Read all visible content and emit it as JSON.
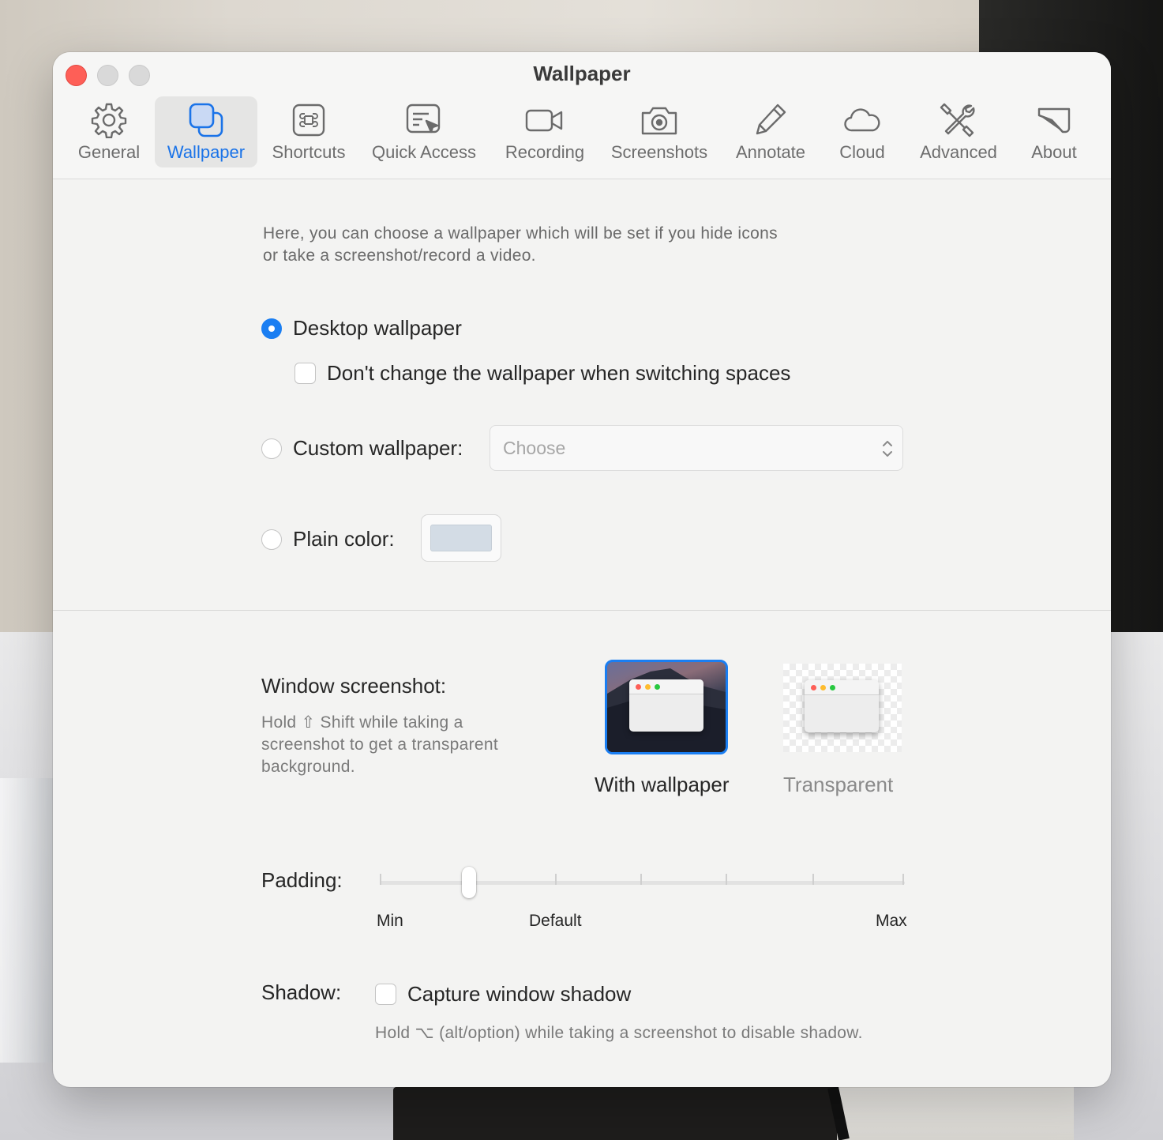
{
  "window": {
    "title": "Wallpaper"
  },
  "toolbar": {
    "items": [
      {
        "label": "General",
        "icon": "gear-icon"
      },
      {
        "label": "Wallpaper",
        "icon": "overlapping-squares-icon",
        "active": true
      },
      {
        "label": "Shortcuts",
        "icon": "command-key-icon"
      },
      {
        "label": "Quick Access",
        "icon": "quick-access-icon"
      },
      {
        "label": "Recording",
        "icon": "video-camera-icon"
      },
      {
        "label": "Screenshots",
        "icon": "camera-icon"
      },
      {
        "label": "Annotate",
        "icon": "pencil-icon"
      },
      {
        "label": "Cloud",
        "icon": "cloud-icon"
      },
      {
        "label": "Advanced",
        "icon": "tools-icon"
      },
      {
        "label": "About",
        "icon": "about-icon"
      }
    ],
    "active_color": "#1a73e8"
  },
  "wallpaper": {
    "intro_line1": "Here, you can choose a wallpaper which will be set if you hide icons",
    "intro_line2": "or take a screenshot/record a video.",
    "desktop_label": "Desktop wallpaper",
    "desktop_selected": true,
    "dont_change_label": "Don't change the wallpaper when switching spaces",
    "dont_change_checked": false,
    "custom_label": "Custom wallpaper:",
    "custom_selected": false,
    "custom_placeholder": "Choose",
    "plain_label": "Plain color:",
    "plain_selected": false,
    "plain_color": "#d3dce5"
  },
  "window_screenshot": {
    "title": "Window screenshot:",
    "hint_line1": "Hold ⇧ Shift while taking a",
    "hint_line2": "screenshot to get a transparent",
    "hint_line3": "background.",
    "option_with_wallpaper": "With wallpaper",
    "option_transparent": "Transparent",
    "selected": "With wallpaper"
  },
  "padding": {
    "label": "Padding:",
    "min_label": "Min",
    "default_label": "Default",
    "max_label": "Max",
    "value_fraction": 0.17
  },
  "shadow": {
    "label": "Shadow:",
    "capture_label": "Capture window shadow",
    "capture_checked": false,
    "hint": "Hold ⌥ (alt/option) while taking a screenshot to disable shadow."
  },
  "colors": {
    "accent": "#1a7ef2",
    "close": "#fe5f57"
  }
}
